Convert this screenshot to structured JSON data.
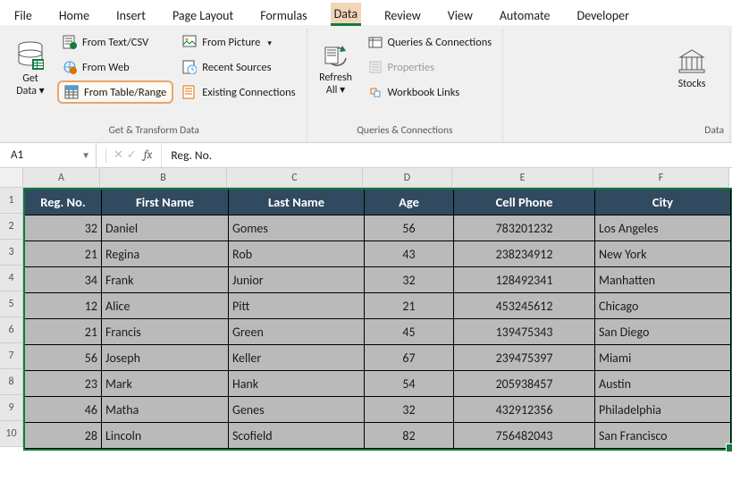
{
  "ribbon_tabs": [
    "File",
    "Home",
    "Insert",
    "Page Layout",
    "Formulas",
    "Data",
    "Review",
    "View",
    "Automate",
    "Developer"
  ],
  "active_tab": 5,
  "ribbon": {
    "get_data": "Get Data",
    "from_text_csv": "From Text/CSV",
    "from_web": "From Web",
    "from_table_range": "From Table/Range",
    "from_picture": "From Picture",
    "recent_sources": "Recent Sources",
    "existing_connections": "Existing Connections",
    "group1_label": "Get & Transform Data",
    "refresh_all": "Refresh All",
    "queries_connections": "Queries & Connections",
    "properties": "Properties",
    "workbook_links": "Workbook Links",
    "group2_label": "Queries & Connections",
    "stocks": "Stocks",
    "group3_label": "Data "
  },
  "name_box": "A1",
  "formula_value": "Reg. No.",
  "columns": [
    "A",
    "B",
    "C",
    "D",
    "E",
    "F"
  ],
  "table": {
    "headers": [
      "Reg. No.",
      "First Name",
      "Last Name",
      "Age",
      "Cell Phone",
      "City"
    ],
    "rows": [
      [
        "32",
        "Daniel",
        "Gomes",
        "56",
        "783201232",
        "Los Angeles"
      ],
      [
        "21",
        "Regina",
        "Rob",
        "43",
        "238234912",
        "New York"
      ],
      [
        "34",
        "Frank",
        "Junior",
        "32",
        "128492341",
        "Manhatten"
      ],
      [
        "12",
        "Alice",
        "Pitt",
        "21",
        "453245612",
        "Chicago"
      ],
      [
        "21",
        "Francis",
        "Green",
        "45",
        "139475343",
        "San Diego"
      ],
      [
        "56",
        "Joseph",
        "Keller",
        "67",
        "239475397",
        "Miami"
      ],
      [
        "23",
        "Mark",
        "Hank",
        "54",
        "205938457",
        "Austin"
      ],
      [
        "46",
        "Matha",
        "Genes",
        "32",
        "432912356",
        "Philadelphia"
      ],
      [
        "28",
        "Lincoln",
        "Scofield",
        "82",
        "756482043",
        "San Francisco"
      ]
    ]
  }
}
